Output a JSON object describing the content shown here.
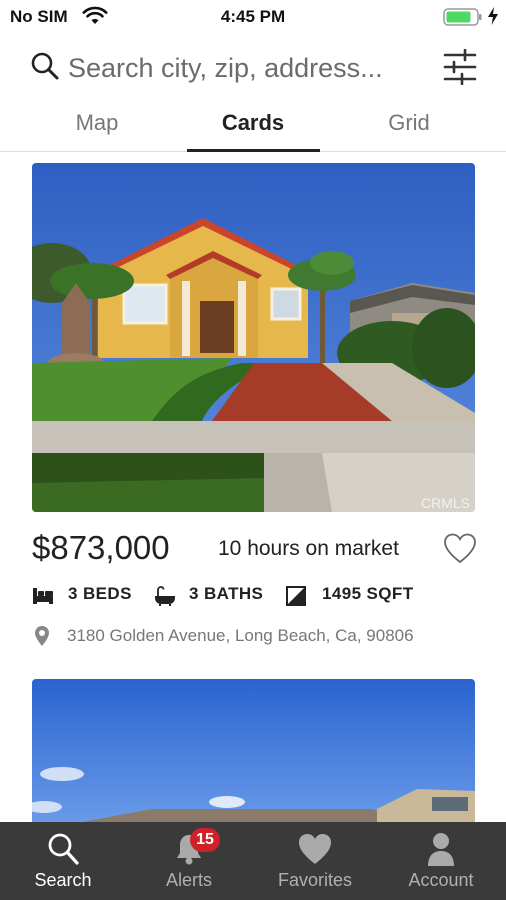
{
  "status_bar": {
    "carrier": "No SIM",
    "time": "4:45 PM",
    "battery_color": "#4cd964"
  },
  "search": {
    "placeholder": "Search city, zip, address...",
    "icons": [
      "search-icon",
      "filter-sliders-icon"
    ]
  },
  "view_tabs": [
    {
      "label": "Map",
      "active": false
    },
    {
      "label": "Cards",
      "active": true
    },
    {
      "label": "Grid",
      "active": false
    }
  ],
  "listings": [
    {
      "price": "$873,000",
      "market_time": "10 hours on market",
      "beds": "3 BEDS",
      "baths": "3 BATHS",
      "sqft": "1495 SQFT",
      "address": "3180 Golden Avenue, Long Beach, Ca, 90806",
      "photo_watermark": "CRMLS",
      "favorited": false
    },
    {
      "photo_description_hidden": true
    }
  ],
  "bottom_nav": {
    "items": [
      {
        "label": "Search",
        "icon": "search-icon",
        "active": true
      },
      {
        "label": "Alerts",
        "icon": "bell-icon",
        "active": false,
        "badge": "15"
      },
      {
        "label": "Favorites",
        "icon": "heart-icon",
        "active": false
      },
      {
        "label": "Account",
        "icon": "person-icon",
        "active": false
      }
    ],
    "background": "#3a3a3a",
    "badge_color": "#d0202a"
  }
}
